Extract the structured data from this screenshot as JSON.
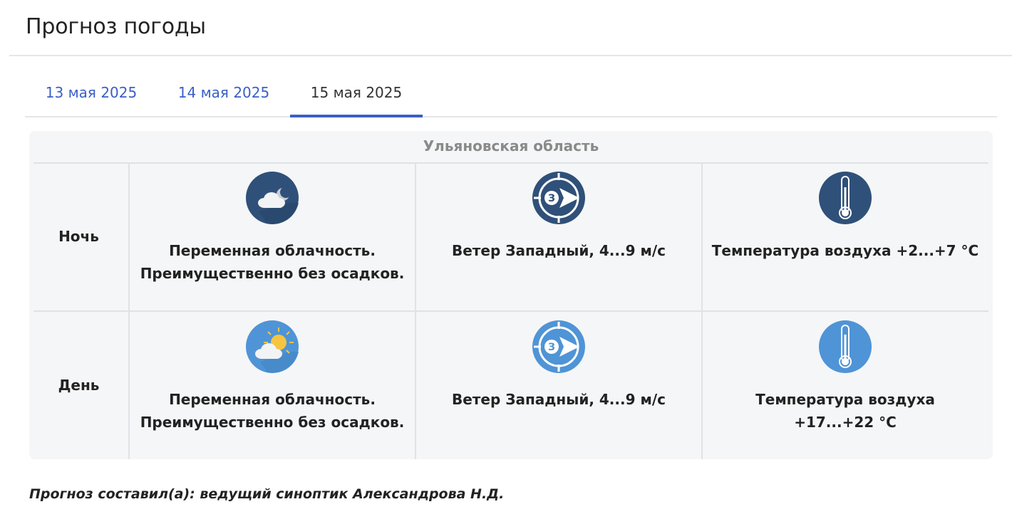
{
  "page": {
    "title": "Прогноз погоды"
  },
  "tabs": [
    {
      "label": "13 мая 2025",
      "active": false
    },
    {
      "label": "14 мая 2025",
      "active": false
    },
    {
      "label": "15 мая 2025",
      "active": true
    }
  ],
  "forecast": {
    "region": "Ульяновская область",
    "rows": [
      {
        "period": "Ночь",
        "cloud": {
          "icon": "partly-cloudy-night-icon",
          "text": "Переменная облачность. Преимущественно без осадков."
        },
        "wind": {
          "icon": "wind-direction-west-icon",
          "direction_letter": "З",
          "text": "Ветер Западный, 4...9 м/с"
        },
        "temp": {
          "icon": "thermometer-icon",
          "text": "Температура воздуха +2...+7 °С"
        }
      },
      {
        "period": "День",
        "cloud": {
          "icon": "partly-cloudy-day-icon",
          "text": "Переменная облачность. Преимущественно без осадков."
        },
        "wind": {
          "icon": "wind-direction-west-icon",
          "direction_letter": "З",
          "text": "Ветер Западный, 4...9 м/с"
        },
        "temp": {
          "icon": "thermometer-icon",
          "text": "Температура воздуха +17...+22 °С"
        }
      }
    ]
  },
  "colors": {
    "night_icon": "#2f5079",
    "day_icon": "#4f94d6",
    "accent": "#3a5fc8"
  },
  "footer": {
    "author": "Прогноз составил(а): ведущий синоптик Александрова Н.Д."
  }
}
